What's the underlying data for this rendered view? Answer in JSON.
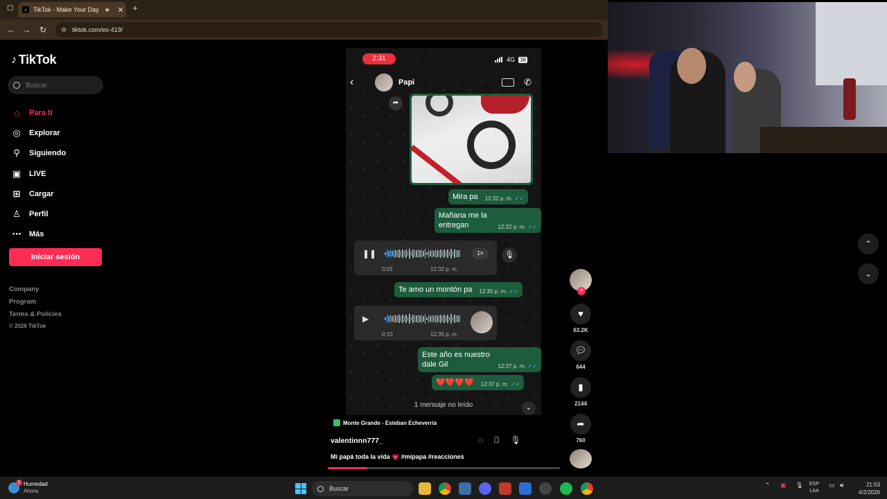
{
  "browser": {
    "tab_title": "TikTok - Make Your Day",
    "tab_favicon": "tiktok-logo",
    "url": "tiktok.com/es-419/"
  },
  "sidebar": {
    "logo": "TikTok",
    "search_placeholder": "Buscar",
    "nav": [
      {
        "label": "Para ti",
        "icon": "home-icon",
        "active": true
      },
      {
        "label": "Explorar",
        "icon": "compass-icon"
      },
      {
        "label": "Siguiendo",
        "icon": "person-icon"
      },
      {
        "label": "LIVE",
        "icon": "live-icon"
      },
      {
        "label": "Cargar",
        "icon": "upload-plus-icon"
      },
      {
        "label": "Perfil",
        "icon": "profile-icon"
      },
      {
        "label": "Más",
        "icon": "more-icon"
      }
    ],
    "login": "Iniciar sesión",
    "footer": {
      "company": "Company",
      "program": "Program",
      "terms": "Terms & Policies",
      "copyright": "© 2026 TikTok"
    }
  },
  "video": {
    "status_time": "2:31",
    "network": "4G",
    "battery": "38",
    "chat_name": "Papi",
    "photo_time": "12:31 p. m.",
    "messages": [
      {
        "text": "Mira pa",
        "time": "12:32 p. m."
      },
      {
        "text": "Mañana me la entregan",
        "time": "12:32 p. m."
      },
      {
        "text": "Te amo un montón pa",
        "time": "12:35 p. m."
      },
      {
        "text": "Este año es nuestro dale Gil",
        "time": "12:37 p. m."
      },
      {
        "text": "❤️❤️❤️❤️",
        "time": "12:37 p. m."
      }
    ],
    "audio1": {
      "duration": "0:03",
      "time": "12:32 p. m.",
      "speed": "1×",
      "progress": 0.1
    },
    "audio2": {
      "duration": "0:10",
      "time": "12:35 p. m.",
      "progress": 0.05
    },
    "unread": "1 mensaje no leído",
    "music": "Monte Grande - Esteban Echeverría",
    "author": "valentinnn777_",
    "caption": "Mi papá toda la vida 💗 #mipapa #reacciones",
    "progress": 0.17
  },
  "actions": {
    "likes": "63.2K",
    "comments": "644",
    "saves": "2144",
    "shares": "760"
  },
  "taskbar": {
    "weather_title": "Humedad",
    "weather_sub": "Ahora",
    "weather_badge": "1",
    "search": "Buscar",
    "lang1": "ESP",
    "lang2": "LAA",
    "time": "21:53",
    "date": "4/2/2026"
  },
  "colors": {
    "accent": "#fe2c55",
    "chat_bubble": "#1d5c3d",
    "browser_chrome": "#2b2117"
  }
}
